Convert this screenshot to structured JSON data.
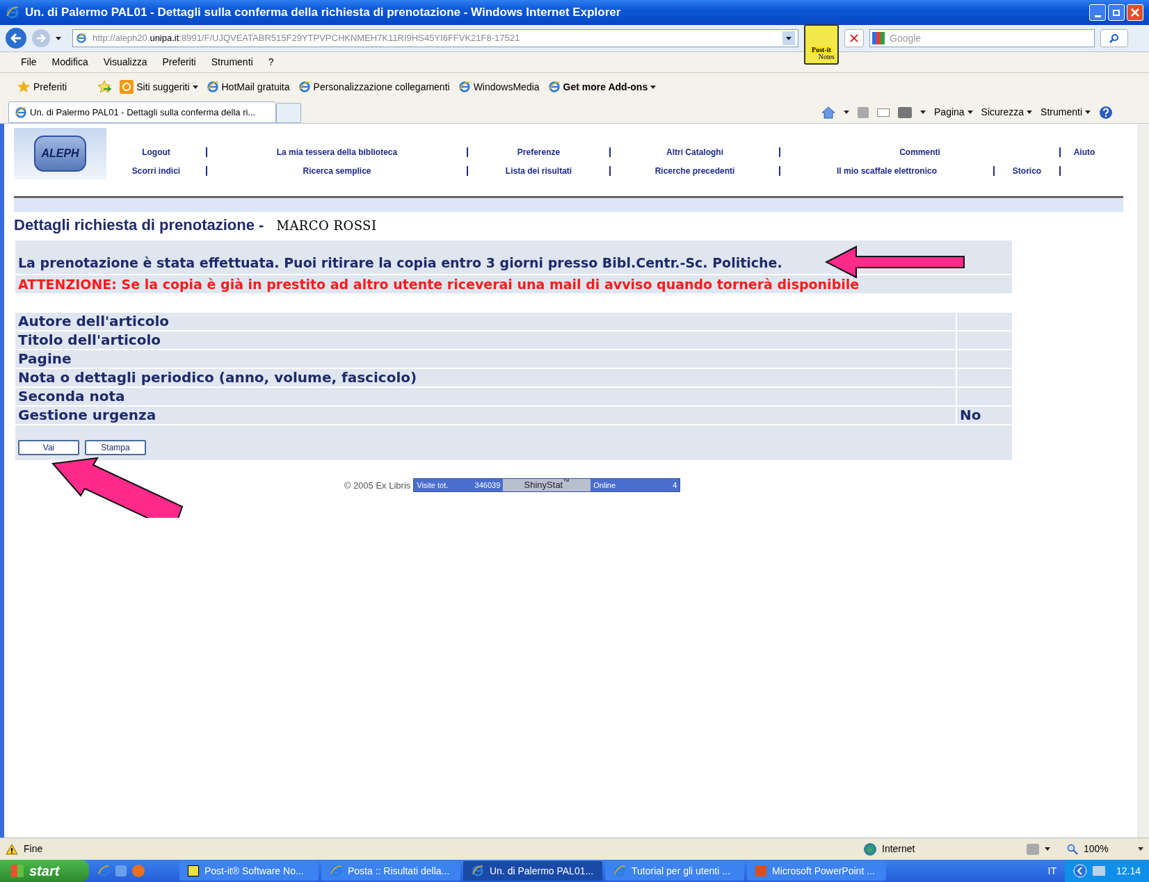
{
  "window": {
    "title": "Un. di Palermo PAL01 - Dettagli sulla conferma della richiesta di prenotazione - Windows Internet Explorer"
  },
  "address_bar": {
    "url_start": "http://aleph20.",
    "url_domain": "unipa.it",
    "url_end": ":8991/F/UJQVEATABR515F29YTPVPCHKNMEH7K11RI9HS45YI6FFVK21F8-17521"
  },
  "postit_badge": {
    "line_1": "Post-it",
    "line_2": "Notes"
  },
  "search": {
    "placeholder": "Google"
  },
  "menu": [
    "File",
    "Modifica",
    "Visualizza",
    "Preferiti",
    "Strumenti",
    "?"
  ],
  "favorites_bar": {
    "favorites": "Preferiti",
    "links": [
      {
        "label": "Siti suggeriti",
        "kind": "dropdown"
      },
      {
        "label": "HotMail gratuita",
        "kind": "page"
      },
      {
        "label": "Personalizzazione collegamenti",
        "kind": "page"
      },
      {
        "label": "WindowsMedia",
        "kind": "page"
      },
      {
        "label": "Get more Add-ons",
        "kind": "addons"
      }
    ]
  },
  "tab": {
    "label": "Un. di Palermo PAL01 - Dettagli sulla conferma della ri..."
  },
  "command_bar": [
    "Pagina",
    "Sicurezza",
    "Strumenti"
  ],
  "page": {
    "logo_text": "ALEPH",
    "nav_rows": [
      [
        "Logout",
        "La mia tessera della biblioteca",
        "Preferenze",
        "Altri Cataloghi",
        "Commenti",
        "Aiuto"
      ],
      [
        "Scorri indici",
        "Ricerca semplice",
        "Lista dei risultati",
        "Ricerche precedenti",
        "Il mio scaffale elettronico",
        "Storico"
      ]
    ],
    "heading": "Dettagli richiesta di prenotazione - ",
    "user_name": "MARCO ROSSI",
    "message": "La prenotazione è stata effettuata. Puoi ritirare la copia entro 3 giorni presso Bibl.Centr.-Sc. Politiche.",
    "warning": "ATTENZIONE: Se la copia è già in prestito ad altro utente riceverai una mail di avviso quando tornerà disponibile",
    "fields": [
      {
        "label": "Autore dell'articolo"
      },
      {
        "label": "Titolo dell'articolo"
      },
      {
        "label": "Pagine"
      },
      {
        "label": "Nota o dettagli periodico (anno, volume, fascicolo)"
      },
      {
        "label": "Seconda nota"
      },
      {
        "label": "Gestione urgenza",
        "value": "No"
      }
    ],
    "buttons": [
      "Vai",
      "Stampa"
    ],
    "copyright": "© 2005 Ex Libris",
    "counter": {
      "visits_label": "Visite tot.",
      "visits": "346039",
      "brand": "ShinyStat",
      "brand_mark": "™",
      "online_label": "Online",
      "online": "4"
    }
  },
  "status_bar": {
    "text": "Fine",
    "zone": "Internet",
    "zoom": "100%"
  },
  "taskbar": {
    "start": "start",
    "tasks": [
      {
        "label": "Post-it® Software No...",
        "kind": "postit",
        "selected": false
      },
      {
        "label": "Posta :: Risultati della...",
        "kind": "ie",
        "selected": false
      },
      {
        "label": "Un. di Palermo PAL01...",
        "kind": "ie",
        "selected": true
      },
      {
        "label": "Tutorial per gli utenti ...",
        "kind": "ie",
        "selected": false
      },
      {
        "label": "Microsoft PowerPoint ...",
        "kind": "ppt",
        "selected": false
      }
    ],
    "language": "IT",
    "clock": "12.14"
  }
}
